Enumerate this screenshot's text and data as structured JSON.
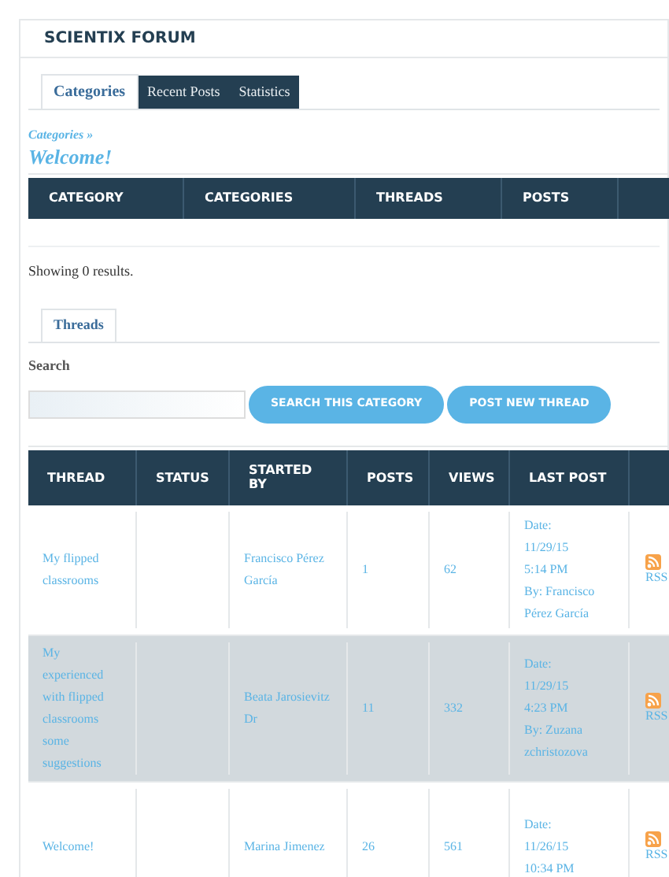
{
  "title": "SCIENTIX FORUM",
  "tabs": [
    {
      "label": "Categories",
      "selected": true
    },
    {
      "label": "Recent Posts",
      "selected": false
    },
    {
      "label": "Statistics",
      "selected": false
    }
  ],
  "breadcrumb": "Categories »",
  "heading": "Welcome!",
  "categories_table": {
    "columns": [
      "CATEGORY",
      "CATEGORIES",
      "THREADS",
      "POSTS"
    ]
  },
  "results": "Showing 0 results.",
  "thread_tabs": [
    {
      "label": "Threads",
      "selected": true
    }
  ],
  "search": {
    "label": "Search"
  },
  "buttons": [
    "SEARCH THIS CATEGORY",
    "POST NEW THREAD"
  ],
  "threads_table": {
    "columns": [
      "THREAD",
      "STATUS",
      "STARTED BY",
      "POSTS",
      "VIEWS",
      "LAST POST"
    ],
    "rows": [
      {
        "thread": "My flipped classrooms",
        "started_by": "Francisco Pérez García",
        "posts": "1",
        "views": "62",
        "last_post": [
          "Date:",
          "11/29/15",
          "5:14 PM",
          "By: Francisco Pérez García"
        ],
        "rss": "RSS",
        "selected": false
      },
      {
        "thread": "My experienced with flipped classrooms some suggestions",
        "started_by": "Beata Jarosievitz Dr",
        "posts": "11",
        "views": "332",
        "last_post": [
          "Date:",
          "11/29/15",
          "4:23 PM",
          "By: Zuzana zchristozova"
        ],
        "rss": "RSS",
        "selected": true
      },
      {
        "thread": "Welcome!",
        "started_by": "Marina Jimenez",
        "posts": "26",
        "views": "561",
        "last_post": [
          "Date:",
          "11/26/15",
          "10:34 PM"
        ],
        "rss": "RSS",
        "selected": false
      }
    ]
  }
}
